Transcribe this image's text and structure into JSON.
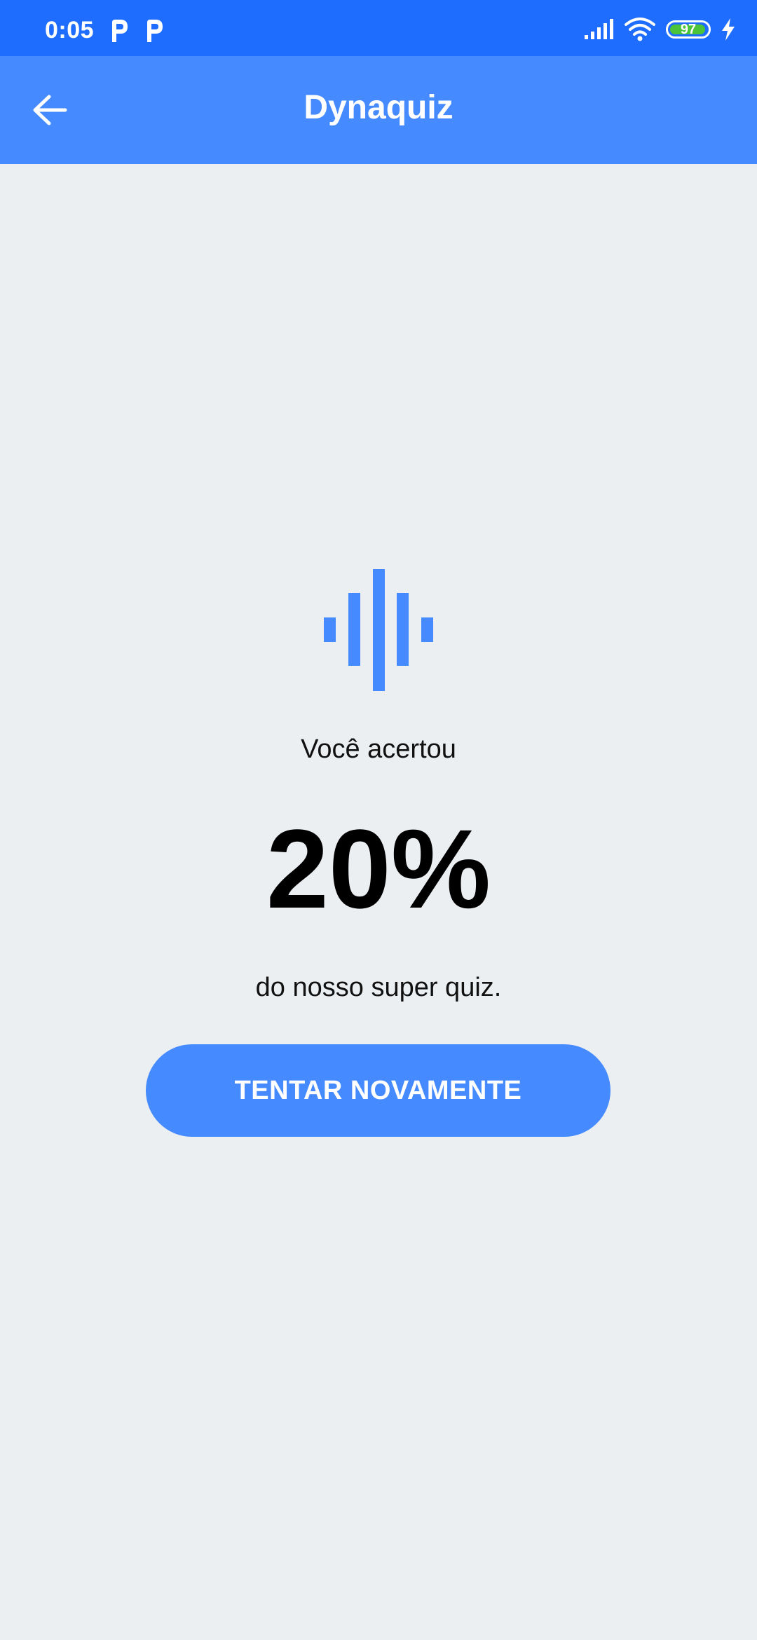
{
  "status_bar": {
    "time": "0:05",
    "battery_level": "97",
    "battery_fraction": 0.97,
    "notification_icons": [
      "p-app-icon",
      "p-app-icon"
    ],
    "system_icons": [
      "signal-icon",
      "wifi-icon",
      "battery-icon",
      "charging-icon"
    ],
    "background_color": "#1E6DFF"
  },
  "app_bar": {
    "title": "Dynaquiz",
    "back_icon": "arrow-left-icon",
    "background_color": "#458BFF"
  },
  "result": {
    "logo_icon": "audio-bars-logo-icon",
    "intro": "Você acertou",
    "score": "20%",
    "outro": "do nosso super quiz."
  },
  "actions": {
    "retry_label": "TENTAR NOVAMENTE"
  },
  "colors": {
    "accent": "#458BFF",
    "page_background": "#ECEFF2",
    "battery_green": "#4CC43A"
  }
}
